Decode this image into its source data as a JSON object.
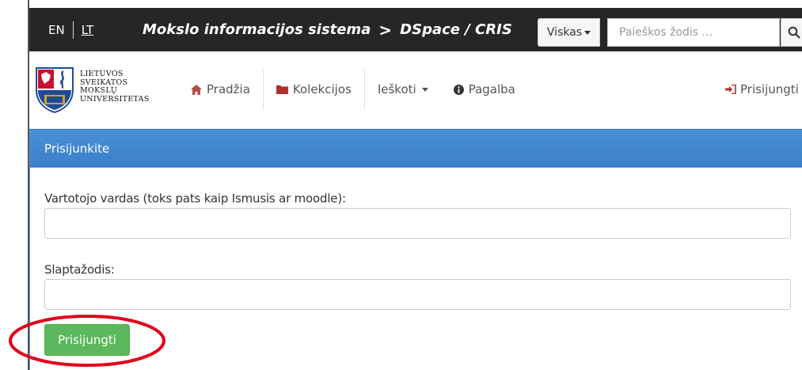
{
  "topbar": {
    "lang_en": "EN",
    "lang_lt": "LT",
    "brand_left": "Mokslo informacijos sistema",
    "brand_chevron": ">",
    "brand_right": "DSpace / CRIS",
    "scope_label": "Viskas",
    "search_placeholder": "Paieškos žodis ..."
  },
  "logo": {
    "lines": [
      "LIETUVOS",
      "SVEIKATOS",
      "MOKSLŲ",
      "UNIVERSITETAS"
    ],
    "colors": {
      "red": "#c8102e",
      "blue": "#1f4a9a",
      "gold": "#d4a017"
    }
  },
  "nav": {
    "home": "Pradžia",
    "collections": "Kolekcijos",
    "search": "Ieškoti",
    "help": "Pagalba",
    "login": "Prisijungti"
  },
  "panel": {
    "title": "Prisijunkite",
    "username_label": "Vartotojo vardas (toks pats kaip Ismusis ar moodle):",
    "username_value": "",
    "password_label": "Slaptažodis:",
    "password_value": "",
    "submit_label": "Prisijungti"
  },
  "colors": {
    "topbar_bg": "#262626",
    "panel_header": "#3a7fc9",
    "button_green": "#5cb85c",
    "annotation_red": "#e0001b"
  },
  "icons": {
    "home": "home-icon",
    "collections": "folder-icon",
    "help": "info-circle-icon",
    "login": "sign-in-icon",
    "search": "search-icon"
  }
}
